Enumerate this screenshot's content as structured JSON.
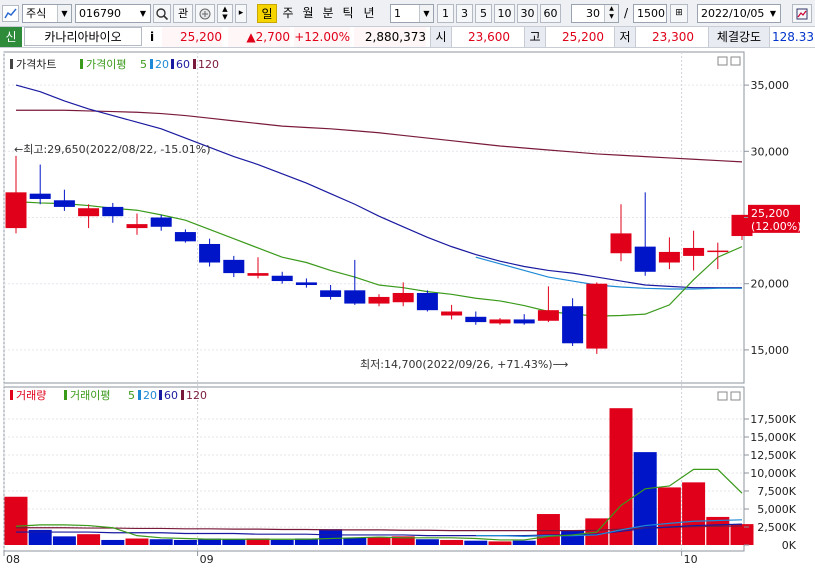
{
  "toolbar": {
    "market": "주식",
    "code": "016790",
    "watch_label": "관",
    "periods": [
      {
        "label": "일",
        "active": true
      },
      {
        "label": "주",
        "active": false
      },
      {
        "label": "월",
        "active": false
      },
      {
        "label": "분",
        "active": false
      },
      {
        "label": "틱",
        "active": false
      },
      {
        "label": "년",
        "active": false
      }
    ],
    "interval": "1",
    "interval_buttons": [
      "1",
      "3",
      "5",
      "10",
      "30",
      "60"
    ],
    "count": "30",
    "count_sep": "/",
    "count_total": "1500",
    "date": "2022/10/05"
  },
  "quote": {
    "badge": "신",
    "name": "카나리아바이오",
    "info": "i",
    "price": "25,200",
    "change": "▲2,700",
    "change_rate": "+12.00%",
    "volume": "2,880,373",
    "open_label": "시",
    "open": "23,600",
    "high_label": "고",
    "high": "25,200",
    "low_label": "저",
    "low": "23,300",
    "strength_label": "체결강도",
    "strength": "128.33"
  },
  "price_panel": {
    "title": "가격차트",
    "ma_title": "가격이평",
    "ma_periods": [
      "5",
      "20",
      "60",
      "120"
    ],
    "axis_labels": [
      "35,000",
      "30,000",
      "25,000",
      "20,000",
      "15,000"
    ],
    "high_annotation": "←최고:29,650(2022/08/22, -15.01%)",
    "low_annotation": "최저:14,700(2022/09/26, +71.43%)⟶",
    "last_price_label": "25,200",
    "last_rate_label": "(12.00%)"
  },
  "volume_panel": {
    "title": "거래량",
    "ma_title": "거래이평",
    "ma_periods": [
      "5",
      "20",
      "60",
      "120"
    ],
    "axis_labels": [
      "17,500K",
      "15,000K",
      "12,500K",
      "10,000K",
      "7,500K",
      "5,000K",
      "2,500K",
      "0K"
    ]
  },
  "x_axis": {
    "labels": [
      {
        "text": "08",
        "index": 0
      },
      {
        "text": "09",
        "index": 8
      },
      {
        "text": "10",
        "index": 28
      }
    ]
  },
  "colors": {
    "up": "#e0001a",
    "down": "#0014c8",
    "ma5": "#3a9a1a",
    "ma20": "#1e8ad6",
    "ma60": "#1a1aa0",
    "ma120": "#7a1a3a"
  },
  "chart_data": {
    "type": "candlestick",
    "price_axis": {
      "min": 12500,
      "max": 37500
    },
    "volume_axis": {
      "min": 0,
      "max": 20000
    },
    "candles": [
      {
        "o": 24200,
        "h": 29650,
        "l": 23800,
        "c": 26900,
        "v": 6700
      },
      {
        "o": 26800,
        "h": 29000,
        "l": 26000,
        "c": 26400,
        "v": 2100
      },
      {
        "o": 26300,
        "h": 27100,
        "l": 25500,
        "c": 25800,
        "v": 1200
      },
      {
        "o": 25100,
        "h": 26000,
        "l": 24200,
        "c": 25700,
        "v": 1500
      },
      {
        "o": 25800,
        "h": 26100,
        "l": 24600,
        "c": 25100,
        "v": 700
      },
      {
        "o": 24200,
        "h": 25300,
        "l": 23700,
        "c": 24500,
        "v": 900
      },
      {
        "o": 25000,
        "h": 25200,
        "l": 24000,
        "c": 24300,
        "v": 800
      },
      {
        "o": 23900,
        "h": 24100,
        "l": 23100,
        "c": 23200,
        "v": 700
      },
      {
        "o": 23000,
        "h": 23400,
        "l": 21300,
        "c": 21600,
        "v": 900
      },
      {
        "o": 21800,
        "h": 22100,
        "l": 20500,
        "c": 20800,
        "v": 800
      },
      {
        "o": 20600,
        "h": 22000,
        "l": 20400,
        "c": 20800,
        "v": 900
      },
      {
        "o": 20600,
        "h": 20900,
        "l": 20000,
        "c": 20200,
        "v": 700
      },
      {
        "o": 20100,
        "h": 20400,
        "l": 19700,
        "c": 19900,
        "v": 900
      },
      {
        "o": 19500,
        "h": 19900,
        "l": 18800,
        "c": 19000,
        "v": 2200
      },
      {
        "o": 19500,
        "h": 21800,
        "l": 18400,
        "c": 18500,
        "v": 1000
      },
      {
        "o": 18500,
        "h": 19200,
        "l": 18300,
        "c": 19000,
        "v": 1100
      },
      {
        "o": 18600,
        "h": 20100,
        "l": 18300,
        "c": 19300,
        "v": 1200
      },
      {
        "o": 19300,
        "h": 19500,
        "l": 17900,
        "c": 18000,
        "v": 800
      },
      {
        "o": 17600,
        "h": 18400,
        "l": 17300,
        "c": 17900,
        "v": 700
      },
      {
        "o": 17500,
        "h": 17900,
        "l": 16900,
        "c": 17100,
        "v": 600
      },
      {
        "o": 17000,
        "h": 17400,
        "l": 16900,
        "c": 17300,
        "v": 500
      },
      {
        "o": 17300,
        "h": 17700,
        "l": 16900,
        "c": 17000,
        "v": 600
      },
      {
        "o": 17200,
        "h": 19800,
        "l": 17100,
        "c": 18000,
        "v": 4300
      },
      {
        "o": 18300,
        "h": 18900,
        "l": 15300,
        "c": 15500,
        "v": 2000
      },
      {
        "o": 15100,
        "h": 20100,
        "l": 14700,
        "c": 20000,
        "v": 3700
      },
      {
        "o": 22300,
        "h": 26000,
        "l": 21700,
        "c": 23800,
        "v": 19000
      },
      {
        "o": 22800,
        "h": 26900,
        "l": 20600,
        "c": 20900,
        "v": 12900
      },
      {
        "o": 21600,
        "h": 23500,
        "l": 21100,
        "c": 22400,
        "v": 8000
      },
      {
        "o": 22100,
        "h": 24000,
        "l": 21000,
        "c": 22700,
        "v": 8700
      },
      {
        "o": 22500,
        "h": 23100,
        "l": 21100,
        "c": 22500,
        "v": 3900
      },
      {
        "o": 23600,
        "h": 25200,
        "l": 23300,
        "c": 25200,
        "v": 2900
      }
    ],
    "ma_price": {
      "ma5": [
        26200,
        26100,
        26050,
        25900,
        25700,
        25550,
        25200,
        24800,
        24100,
        23400,
        22700,
        22000,
        21600,
        21000,
        20500,
        19900,
        19700,
        19400,
        19200,
        18900,
        18700,
        18350,
        17900,
        17700,
        17550,
        17600,
        17700,
        18400,
        20300,
        22000,
        22800
      ],
      "ma20": [
        null,
        null,
        null,
        null,
        null,
        null,
        null,
        null,
        null,
        null,
        null,
        null,
        null,
        null,
        null,
        null,
        null,
        null,
        null,
        22000,
        21500,
        21000,
        20500,
        20200,
        19900,
        19750,
        19650,
        19600,
        19600,
        19650,
        19650
      ],
      "ma60": [
        35000,
        34500,
        33800,
        33200,
        32700,
        32200,
        31700,
        31000,
        30300,
        29600,
        29000,
        28300,
        27600,
        26800,
        26000,
        25100,
        24300,
        23500,
        22800,
        22200,
        21700,
        21300,
        21000,
        20800,
        20500,
        20200,
        19900,
        19800,
        19700,
        19700,
        19700
      ],
      "ma120": [
        33100,
        33100,
        33100,
        33050,
        33000,
        32950,
        32850,
        32700,
        32500,
        32300,
        32100,
        31900,
        31800,
        31700,
        31550,
        31400,
        31200,
        31000,
        30800,
        30600,
        30400,
        30250,
        30100,
        29950,
        29800,
        29700,
        29600,
        29500,
        29400,
        29300,
        29200
      ]
    },
    "ma_volume": {
      "ma5": [
        2600,
        2800,
        2800,
        2700,
        2400,
        1300,
        1000,
        900,
        800,
        800,
        800,
        800,
        800,
        900,
        1000,
        1100,
        1000,
        1000,
        1000,
        900,
        700,
        700,
        1200,
        1400,
        1800,
        5500,
        7800,
        8200,
        10500,
        10500,
        7200
      ],
      "ma20": [
        null,
        null,
        null,
        null,
        null,
        null,
        null,
        null,
        null,
        null,
        null,
        null,
        null,
        null,
        null,
        null,
        null,
        null,
        null,
        1300,
        1300,
        1200,
        1300,
        1300,
        1400,
        2100,
        2700,
        3000,
        3300,
        3400,
        3500
      ],
      "ma60": [
        1800,
        1800,
        1800,
        1800,
        1700,
        1700,
        1700,
        1600,
        1600,
        1600,
        1500,
        1500,
        1500,
        1400,
        1400,
        1400,
        1400,
        1300,
        1300,
        1300,
        1300,
        1300,
        1400,
        1400,
        1500,
        1900,
        2300,
        2500,
        2700,
        2800,
        2900
      ],
      "ma120": [
        2400,
        2400,
        2400,
        2350,
        2350,
        2300,
        2300,
        2250,
        2250,
        2200,
        2200,
        2150,
        2150,
        2100,
        2100,
        2100,
        2050,
        2050,
        2000,
        2000,
        2000,
        2000,
        2000,
        2000,
        2050,
        2200,
        2350,
        2450,
        2550,
        2600,
        2650
      ]
    }
  }
}
